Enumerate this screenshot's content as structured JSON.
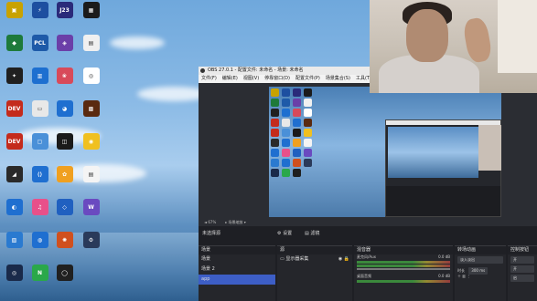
{
  "desktop": {
    "icons": [
      {
        "label": "",
        "color": "#c8a200",
        "glyph": "▣"
      },
      {
        "label": "",
        "color": "#1d4fa0",
        "glyph": "⚡"
      },
      {
        "label": "",
        "color": "#2a2a7a",
        "glyph": "J23"
      },
      {
        "label": "",
        "color": "#1b1b1b",
        "glyph": "▦"
      },
      {
        "label": "",
        "color": "#1e7a3a",
        "glyph": "◆"
      },
      {
        "label": "",
        "color": "#1e5aa8",
        "glyph": "PCL"
      },
      {
        "label": "",
        "color": "#6b3fa8",
        "glyph": "◈"
      },
      {
        "label": "",
        "color": "#f0f0f0",
        "glyph": "▤"
      },
      {
        "label": "",
        "color": "#202020",
        "glyph": "✦"
      },
      {
        "label": "",
        "color": "#1d6fd0",
        "glyph": "▥"
      },
      {
        "label": "",
        "color": "#d84a5a",
        "glyph": "❀"
      },
      {
        "label": "",
        "color": "#ffffff",
        "glyph": "◎"
      },
      {
        "label": "",
        "color": "#c42b1c",
        "glyph": "DEV"
      },
      {
        "label": "",
        "color": "#e8e8e8",
        "glyph": "▭"
      },
      {
        "label": "",
        "color": "#1f6fd0",
        "glyph": "◕"
      },
      {
        "label": "",
        "color": "#5a2a10",
        "glyph": "▩"
      },
      {
        "label": "",
        "color": "#c42b1c",
        "glyph": "DEV"
      },
      {
        "label": "",
        "color": "#4a90d8",
        "glyph": "▢"
      },
      {
        "label": "",
        "color": "#1a1a1a",
        "glyph": "◫"
      },
      {
        "label": "",
        "color": "#f0c020",
        "glyph": "◉"
      },
      {
        "label": "",
        "color": "#2a2a2a",
        "glyph": "◢"
      },
      {
        "label": "",
        "color": "#1f6fd0",
        "glyph": "⟨⟩"
      },
      {
        "label": "",
        "color": "#f0a020",
        "glyph": "✿"
      },
      {
        "label": "",
        "color": "#f4f4f4",
        "glyph": "▤"
      },
      {
        "label": "",
        "color": "#1f6fd0",
        "glyph": "◐"
      },
      {
        "label": "",
        "color": "#e8508a",
        "glyph": "♫"
      },
      {
        "label": "",
        "color": "#2060c0",
        "glyph": "◇"
      },
      {
        "label": "",
        "color": "#6a4ac0",
        "glyph": "W"
      },
      {
        "label": "",
        "color": "#2a7ad0",
        "glyph": "▧"
      },
      {
        "label": "",
        "color": "#1f6fd0",
        "glyph": "◍"
      },
      {
        "label": "",
        "color": "#d0501e",
        "glyph": "✺"
      },
      {
        "label": "",
        "color": "#2a3a5a",
        "glyph": "⚙"
      },
      {
        "label": "",
        "color": "#1a2a4a",
        "glyph": "◎"
      },
      {
        "label": "",
        "color": "#2aa84a",
        "glyph": "N"
      },
      {
        "label": "",
        "color": "#202020",
        "glyph": "◯"
      }
    ]
  },
  "obs": {
    "title": "OBS 27.0.1 - 配置文件: 未命名 - 场景: 未命名",
    "menu": [
      "文件(F)",
      "编辑(E)",
      "视图(V)",
      "停靠窗口(D)",
      "配置文件(P)",
      "场景集合(S)",
      "工具(T)",
      "帮助(H)"
    ],
    "toolbar": [
      "◄  67%",
      "▸  场景缩放 ▾"
    ],
    "tabs": {
      "no_source": "未选择源",
      "properties": "设置",
      "filters": "滤镜"
    },
    "scenes": {
      "title": "场景",
      "items": [
        "场景",
        "场景 2",
        "app"
      ],
      "selected_index": 2
    },
    "sources": {
      "title": "源",
      "items": [
        "显示器采集"
      ]
    },
    "mixer": {
      "title": "混音器",
      "channels": [
        {
          "name": "麦克风/Aux",
          "db": "0.0 dB"
        },
        {
          "name": "桌面音频",
          "db": "0.0 dB"
        }
      ]
    },
    "transitions": {
      "title": "转场动画",
      "type": "淡入淡出",
      "duration_label": "时长",
      "duration": "300 ms"
    },
    "controls": {
      "title": "控制按钮",
      "buttons": [
        "开",
        "开",
        "启"
      ]
    }
  },
  "colors": {
    "selected": "#3d5ec6",
    "obs_bg": "#1e1f24"
  }
}
